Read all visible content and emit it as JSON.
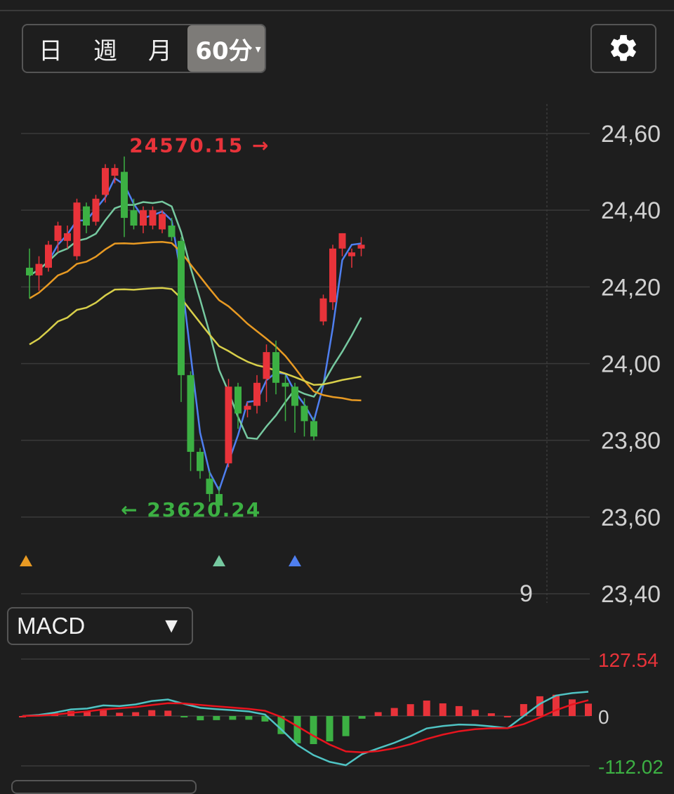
{
  "toolbar": {
    "periods": [
      {
        "label": "日"
      },
      {
        "label": "週"
      },
      {
        "label": "月"
      },
      {
        "label": "60分",
        "caret": "▾"
      }
    ],
    "settings_icon": "gear-icon"
  },
  "indicator_select": {
    "label": "MACD",
    "caret": "▼"
  },
  "colors": {
    "up": "#e8333a",
    "down": "#3cb043",
    "ma_fast": "#4f7ff0",
    "ma_mid": "#76c9a0",
    "ma_slow": "#e89a23",
    "ma_long": "#d8cf4a",
    "dif": "#4fc3c3",
    "dea": "#e8141e"
  },
  "chart_data": [
    {
      "type": "candlestick",
      "y_ticks": [
        "24,60",
        "24,40",
        "24,20",
        "24,00",
        "23,80",
        "23,60",
        "23,40"
      ],
      "y_tick_values": [
        24600,
        24400,
        24200,
        24000,
        23800,
        23600,
        23400
      ],
      "ylim": [
        23400,
        24600
      ],
      "x_label": "9",
      "grid": true,
      "annotations": [
        {
          "text": "24570.15",
          "arrow": "→",
          "value": 24570.15,
          "index": 25,
          "color": "up"
        },
        {
          "text": "23620.24",
          "arrow": "←",
          "value": 23620.24,
          "index": 10,
          "color": "down"
        }
      ],
      "markers": [
        {
          "index": 0,
          "color": "ma_slow"
        },
        {
          "index": 20,
          "color": "ma_mid"
        },
        {
          "index": 28,
          "color": "ma_fast"
        }
      ],
      "candles": [
        [
          24250,
          24230,
          24300,
          24170
        ],
        [
          24230,
          24260,
          24280,
          24190
        ],
        [
          24250,
          24310,
          24320,
          24240
        ],
        [
          24320,
          24360,
          24370,
          24290
        ],
        [
          24320,
          24340,
          24360,
          24300
        ],
        [
          24280,
          24420,
          24430,
          24270
        ],
        [
          24410,
          24360,
          24420,
          24340
        ],
        [
          24370,
          24430,
          24440,
          24360
        ],
        [
          24440,
          24510,
          24520,
          24420
        ],
        [
          24490,
          24510,
          24520,
          24470
        ],
        [
          24500,
          24380,
          24540,
          24330
        ],
        [
          24400,
          24360,
          24430,
          24350
        ],
        [
          24360,
          24400,
          24410,
          24340
        ],
        [
          24360,
          24400,
          24410,
          24350
        ],
        [
          24350,
          24390,
          24400,
          24340
        ],
        [
          24360,
          24330,
          24380,
          24320
        ],
        [
          24320,
          23970,
          24330,
          23900
        ],
        [
          23970,
          23770,
          23980,
          23720
        ],
        [
          23770,
          23720,
          23780,
          23700
        ],
        [
          23700,
          23660,
          23720,
          23640
        ],
        [
          23660,
          23630,
          23680,
          23620
        ],
        [
          23740,
          23940,
          23960,
          23730
        ],
        [
          23940,
          23870,
          23950,
          23830
        ],
        [
          23880,
          23890,
          23900,
          23860
        ],
        [
          23890,
          23950,
          23970,
          23870
        ],
        [
          23960,
          24030,
          24050,
          23900
        ],
        [
          24030,
          23950,
          24060,
          23920
        ],
        [
          23950,
          23940,
          23970,
          23850
        ],
        [
          23940,
          23890,
          23950,
          23820
        ],
        [
          23890,
          23850,
          23910,
          23810
        ],
        [
          23850,
          23810,
          23860,
          23800
        ],
        [
          24110,
          24170,
          24180,
          24100
        ],
        [
          24160,
          24300,
          24310,
          24140
        ],
        [
          24300,
          24340,
          24340,
          24280
        ],
        [
          24280,
          24290,
          24300,
          24250
        ],
        [
          24300,
          24310,
          24330,
          24280
        ]
      ]
    },
    {
      "type": "macd",
      "y_ticks": [
        "127.54",
        "0",
        "-112.02"
      ],
      "y_tick_values": [
        127.54,
        0,
        -112.02
      ],
      "ylim": [
        -112.02,
        127.54
      ]
    }
  ]
}
